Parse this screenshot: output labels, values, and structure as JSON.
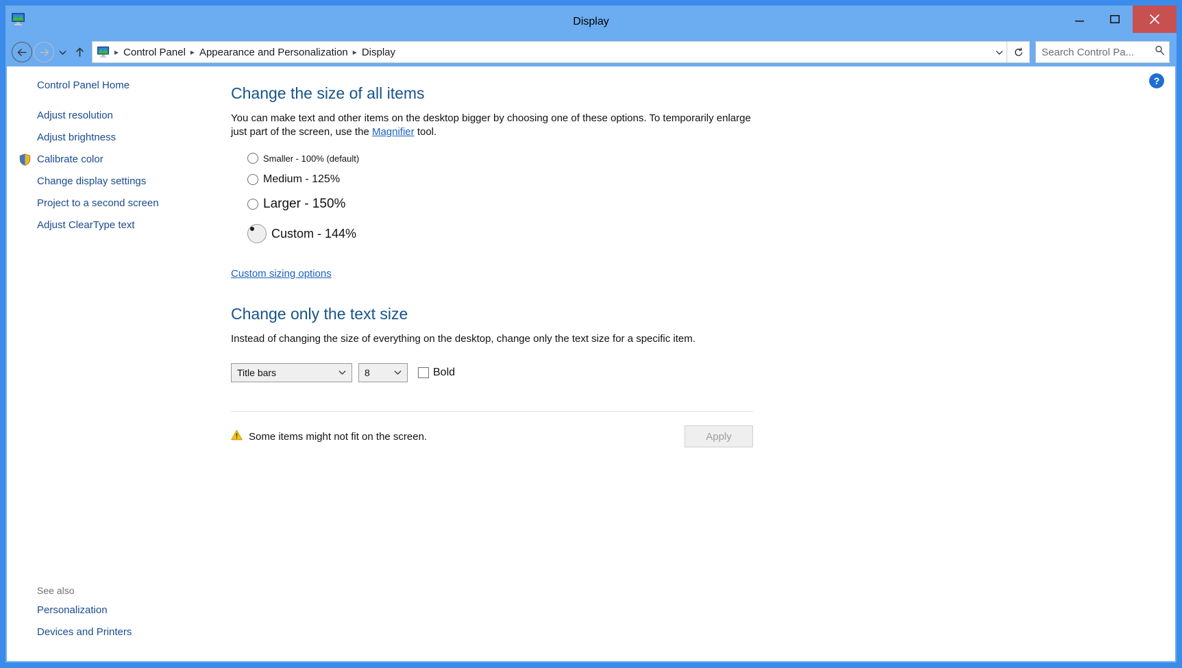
{
  "window": {
    "title": "Display",
    "icon": "display-monitor-icon",
    "controls": {
      "minimize": "minimize-button",
      "maximize": "maximize-button",
      "close": "close-button"
    },
    "close_color": "#c75050",
    "titlebar_color": "#6cacf0"
  },
  "navigation": {
    "back": "back-button",
    "forward": "forward-button",
    "recent": "recent-locations-dropdown",
    "up": "up-one-level-button",
    "refresh": "refresh-button",
    "breadcrumbs": [
      "Control Panel",
      "Appearance and Personalization",
      "Display"
    ],
    "breadcrumb_separator": "▸"
  },
  "search": {
    "placeholder": "Search Control Pa...",
    "icon": "search-icon"
  },
  "sidebar": {
    "home_label": "Control Panel Home",
    "items": [
      {
        "label": "Adjust resolution",
        "shield": false
      },
      {
        "label": "Adjust brightness",
        "shield": false
      },
      {
        "label": "Calibrate color",
        "shield": true
      },
      {
        "label": "Change display settings",
        "shield": false
      },
      {
        "label": "Project to a second screen",
        "shield": false
      },
      {
        "label": "Adjust ClearType text",
        "shield": false
      }
    ],
    "see_also": {
      "title": "See also",
      "items": [
        "Personalization",
        "Devices and Printers"
      ]
    }
  },
  "help": {
    "label": "?"
  },
  "main": {
    "size_section": {
      "heading": "Change the size of all items",
      "description_part1": "You can make text and other items on the desktop bigger by choosing one of these options. To temporarily enlarge just part of the screen, use the ",
      "magnifier_link": "Magnifier",
      "description_part2": " tool.",
      "options": [
        {
          "label": "Smaller - 100% (default)",
          "selected": false
        },
        {
          "label": "Medium - 125%",
          "selected": false
        },
        {
          "label": "Larger - 150%",
          "selected": false
        },
        {
          "label": "Custom - 144%",
          "selected": true
        }
      ],
      "custom_sizing_link": "Custom sizing options"
    },
    "text_section": {
      "heading": "Change only the text size",
      "description": "Instead of changing the size of everything on the desktop, change only the text size for a specific item.",
      "item_select": {
        "value": "Title bars"
      },
      "size_select": {
        "value": "8"
      },
      "bold_checkbox": {
        "label": "Bold",
        "checked": false
      }
    },
    "footer": {
      "warning_icon": "warning-triangle-icon",
      "warning_text": "Some items might not fit on the screen.",
      "apply_label": "Apply",
      "apply_disabled": true
    }
  }
}
